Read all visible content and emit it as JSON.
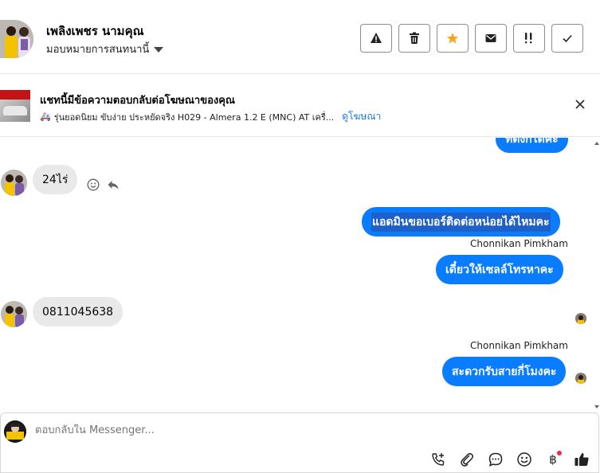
{
  "header": {
    "contact_name": "เพลิงเพชร นามคุณ",
    "assign_label": "มอบหมายการสนทนานี้",
    "actions": [
      {
        "name": "spam-icon",
        "glyph": "warning"
      },
      {
        "name": "trash-icon",
        "glyph": "trash"
      },
      {
        "name": "star-icon",
        "glyph": "star"
      },
      {
        "name": "mail-icon",
        "glyph": "envelope"
      },
      {
        "name": "follow-up-icon",
        "glyph": "alert-bang"
      },
      {
        "name": "check-icon",
        "glyph": "check"
      }
    ],
    "star_color": "#f5a623"
  },
  "ad": {
    "title": "แชทนี้มีข้อความตอบกลับต่อโฆษณาของคุณ",
    "line": "รุ่นยอดนิยม ขับง่าย ประหยัดจริง H029 - Almera 1.2 E (MNC) AT เครื่...",
    "link": "ดูโฆษณา",
    "van_icon": "🚑"
  },
  "messages": {
    "partial_out": "ที่ตั้งก็ได้ค่ะ",
    "in1": "24ไร่",
    "out1": "แอดมินขอเบอร์ติดต่อหน่อยได้ไหมคะ",
    "sender1": "Chonnikan Pimkham",
    "out2": "เดี๋ยวให้เซลล์โทรหาคะ",
    "in2": "0811045638",
    "sender2": "Chonnikan Pimkham",
    "out3": "สะดวกรับสายกี่โมงคะ"
  },
  "composer": {
    "placeholder": "ตอบกลับใน Messenger...",
    "tools": [
      "call-add-icon",
      "attachment-icon",
      "saved-reply-icon",
      "emoji-icon",
      "baht-icon",
      "thumbs-up-icon"
    ],
    "baht_glyph": "฿"
  },
  "colors": {
    "accent": "#0a7cff",
    "incoming": "#e9e9ea",
    "link": "#1877f2"
  }
}
